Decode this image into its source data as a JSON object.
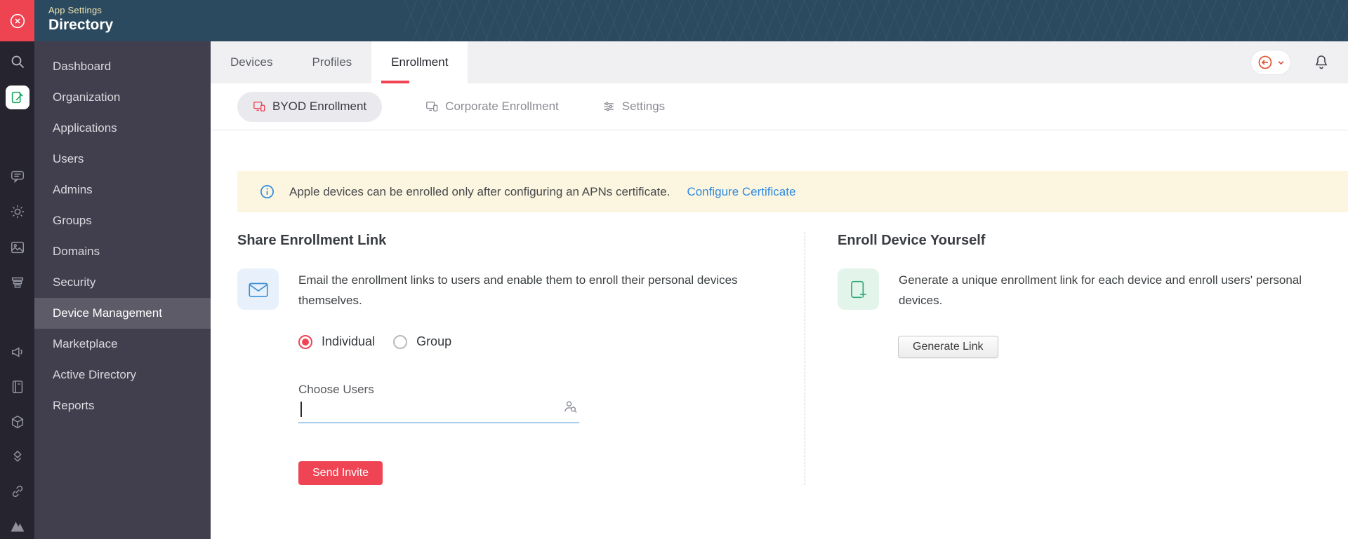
{
  "topband": {
    "app_settings_label": "App Settings",
    "app_title": "Directory"
  },
  "rail_icons": [
    "close-icon",
    "search-icon",
    "directory-app-icon",
    "chat-icon",
    "gear-icon",
    "gallery-icon",
    "stack-icon",
    "megaphone-icon",
    "notebook-icon",
    "cube-icon",
    "layers-icon",
    "link-icon",
    "mountain-logo-icon"
  ],
  "sidebar": {
    "items": [
      {
        "label": "Dashboard",
        "selected": false
      },
      {
        "label": "Organization",
        "selected": false
      },
      {
        "label": "Applications",
        "selected": false
      },
      {
        "label": "Users",
        "selected": false
      },
      {
        "label": "Admins",
        "selected": false
      },
      {
        "label": "Groups",
        "selected": false
      },
      {
        "label": "Domains",
        "selected": false
      },
      {
        "label": "Security",
        "selected": false
      },
      {
        "label": "Device Management",
        "selected": true
      },
      {
        "label": "Marketplace",
        "selected": false
      },
      {
        "label": "Active Directory",
        "selected": false
      },
      {
        "label": "Reports",
        "selected": false
      }
    ]
  },
  "tabs": [
    {
      "label": "Devices",
      "active": false
    },
    {
      "label": "Profiles",
      "active": false
    },
    {
      "label": "Enrollment",
      "active": true
    }
  ],
  "subtabs": [
    {
      "label": "BYOD Enrollment",
      "active": true
    },
    {
      "label": "Corporate Enrollment",
      "active": false
    },
    {
      "label": "Settings",
      "active": false
    }
  ],
  "banner": {
    "message": "Apple devices can be enrolled only after configuring an APNs certificate.",
    "link_label": "Configure Certificate"
  },
  "share_enrollment": {
    "title": "Share Enrollment Link",
    "description": "Email the enrollment links to users and enable them to enroll their personal devices themselves.",
    "radio_options": [
      {
        "label": "Individual",
        "selected": true
      },
      {
        "label": "Group",
        "selected": false
      }
    ],
    "choose_users_label": "Choose Users",
    "choose_users_value": "",
    "send_invite_label": "Send Invite"
  },
  "enroll_yourself": {
    "title": "Enroll Device Yourself",
    "description": "Generate a unique enrollment link for each device and enroll users' personal devices.",
    "generate_link_label": "Generate Link"
  },
  "colors": {
    "accent_red": "#ee4454",
    "topband_teal": "#2b4a5f",
    "sidebar_bg": "#413f4e",
    "rail_bg": "#25242f",
    "banner_yellow": "#fcf6e0",
    "link_blue": "#2f8be0",
    "icon_blue": "#3d8fd6",
    "icon_green": "#2aa876"
  }
}
